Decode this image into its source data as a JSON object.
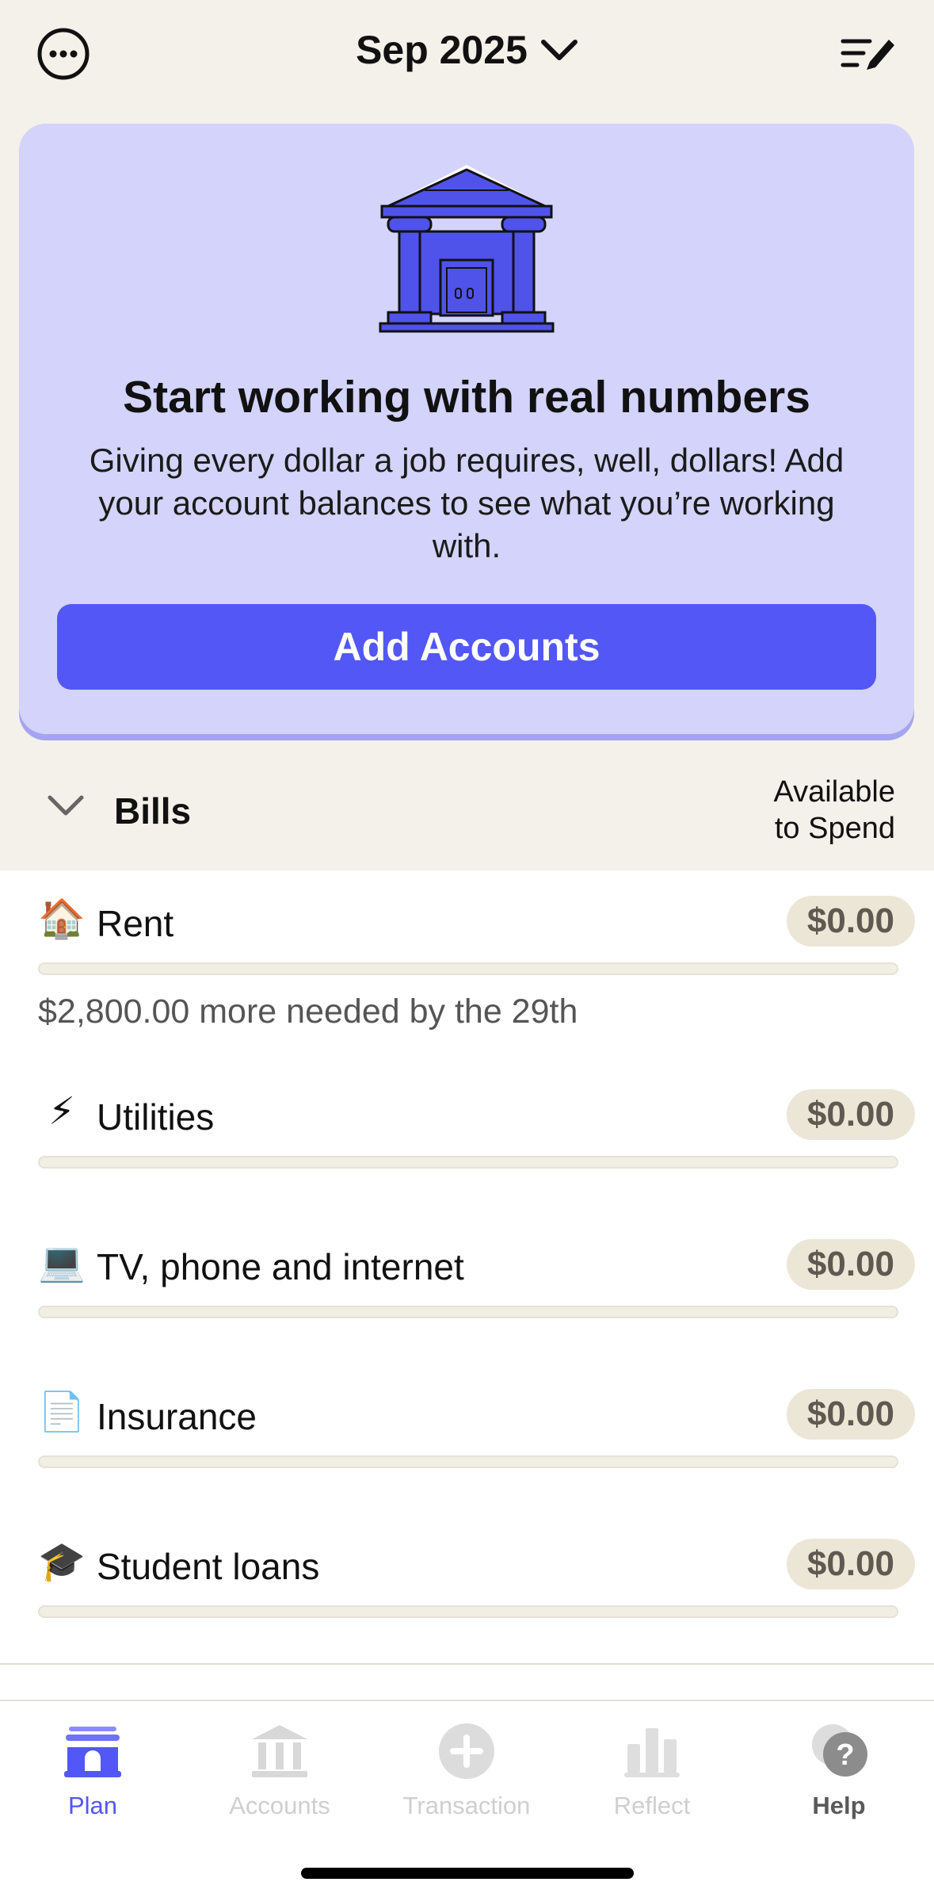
{
  "header": {
    "month_label": "Sep 2025"
  },
  "card": {
    "title": "Start working with real numbers",
    "body": "Giving every dollar a job requires, well, dollars! Add your account balances to see what you’re working with.",
    "button_label": "Add Accounts"
  },
  "section": {
    "title": "Bills",
    "available_label_line1": "Available",
    "available_label_line2": "to Spend"
  },
  "rows": [
    {
      "emoji": "🏠",
      "name": "Rent",
      "amount": "$0.00",
      "note": "$2,800.00 more needed by the 29th",
      "progress": 0
    },
    {
      "emoji": "⚡",
      "name": "Utilities",
      "amount": "$0.00",
      "progress": 0
    },
    {
      "emoji": "💻",
      "name": "TV, phone and internet",
      "amount": "$0.00",
      "progress": 0
    },
    {
      "emoji": "📄",
      "name": "Insurance",
      "amount": "$0.00",
      "progress": 0
    },
    {
      "emoji": "🎓",
      "name": "Student loans",
      "amount": "$0.00",
      "progress": 0
    }
  ],
  "tabs": [
    {
      "label": "Plan",
      "icon": "plan-icon",
      "active": true
    },
    {
      "label": "Accounts",
      "icon": "bank-icon",
      "active": false
    },
    {
      "label": "Transaction",
      "icon": "plus-circle-icon",
      "active": false
    },
    {
      "label": "Reflect",
      "icon": "bar-chart-icon",
      "active": false
    },
    {
      "label": "Help",
      "icon": "help-bubble-icon",
      "active": false
    }
  ],
  "colors": {
    "accent": "#5257f5",
    "card_bg": "#d3d3fb",
    "background": "#f4f1ea"
  }
}
